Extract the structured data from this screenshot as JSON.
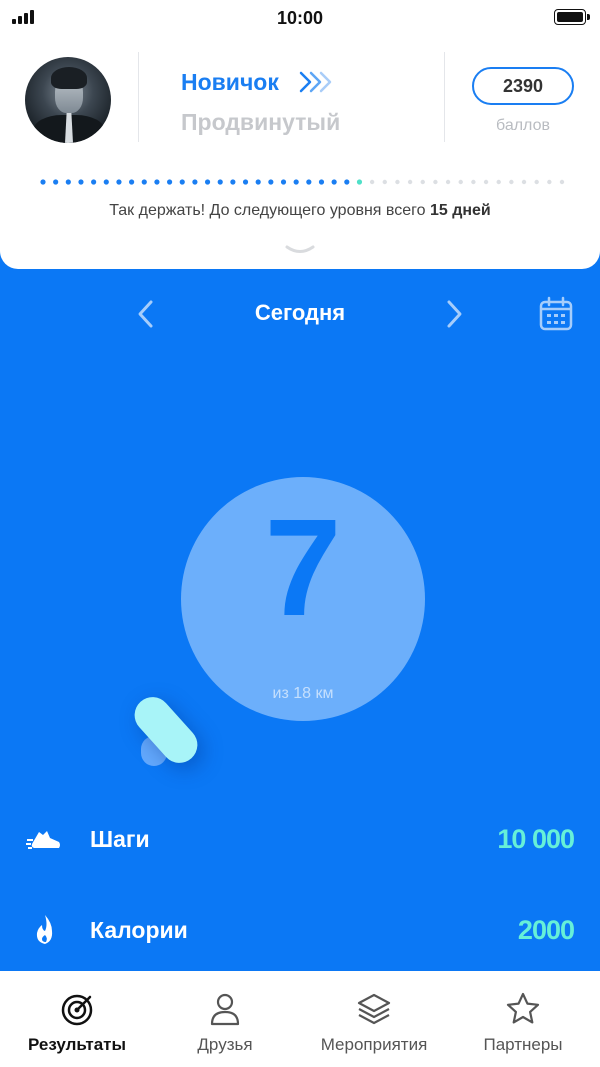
{
  "status_bar": {
    "time": "10:00"
  },
  "profile": {
    "level_current": "Новичок",
    "level_next": "Продвинутый",
    "points": "2390",
    "points_label": "баллов",
    "progress": {
      "filled_dots": 25,
      "total_dots": 42
    },
    "progress_text": "Так держать! До следующего уровня всего",
    "progress_highlight": "15 дней"
  },
  "date_nav": {
    "title": "Сегодня"
  },
  "main_metric": {
    "value": "7",
    "subtitle": "из 18 км"
  },
  "stats": [
    {
      "label": "Шаги",
      "value": "10 000",
      "icon": "sneaker-icon"
    },
    {
      "label": "Калории",
      "value": "2000",
      "icon": "flame-icon"
    }
  ],
  "tabs": [
    {
      "label": "Результаты",
      "icon": "target-icon",
      "active": true
    },
    {
      "label": "Друзья",
      "icon": "user-icon",
      "active": false
    },
    {
      "label": "Мероприятия",
      "icon": "layers-icon",
      "active": false
    },
    {
      "label": "Партнеры",
      "icon": "star-icon",
      "active": false
    }
  ],
  "colors": {
    "primary": "#0b78f5",
    "accent_link": "#1a7ef2",
    "stat_value": "#66f0d8",
    "progress_next": "#4fe0c8"
  }
}
